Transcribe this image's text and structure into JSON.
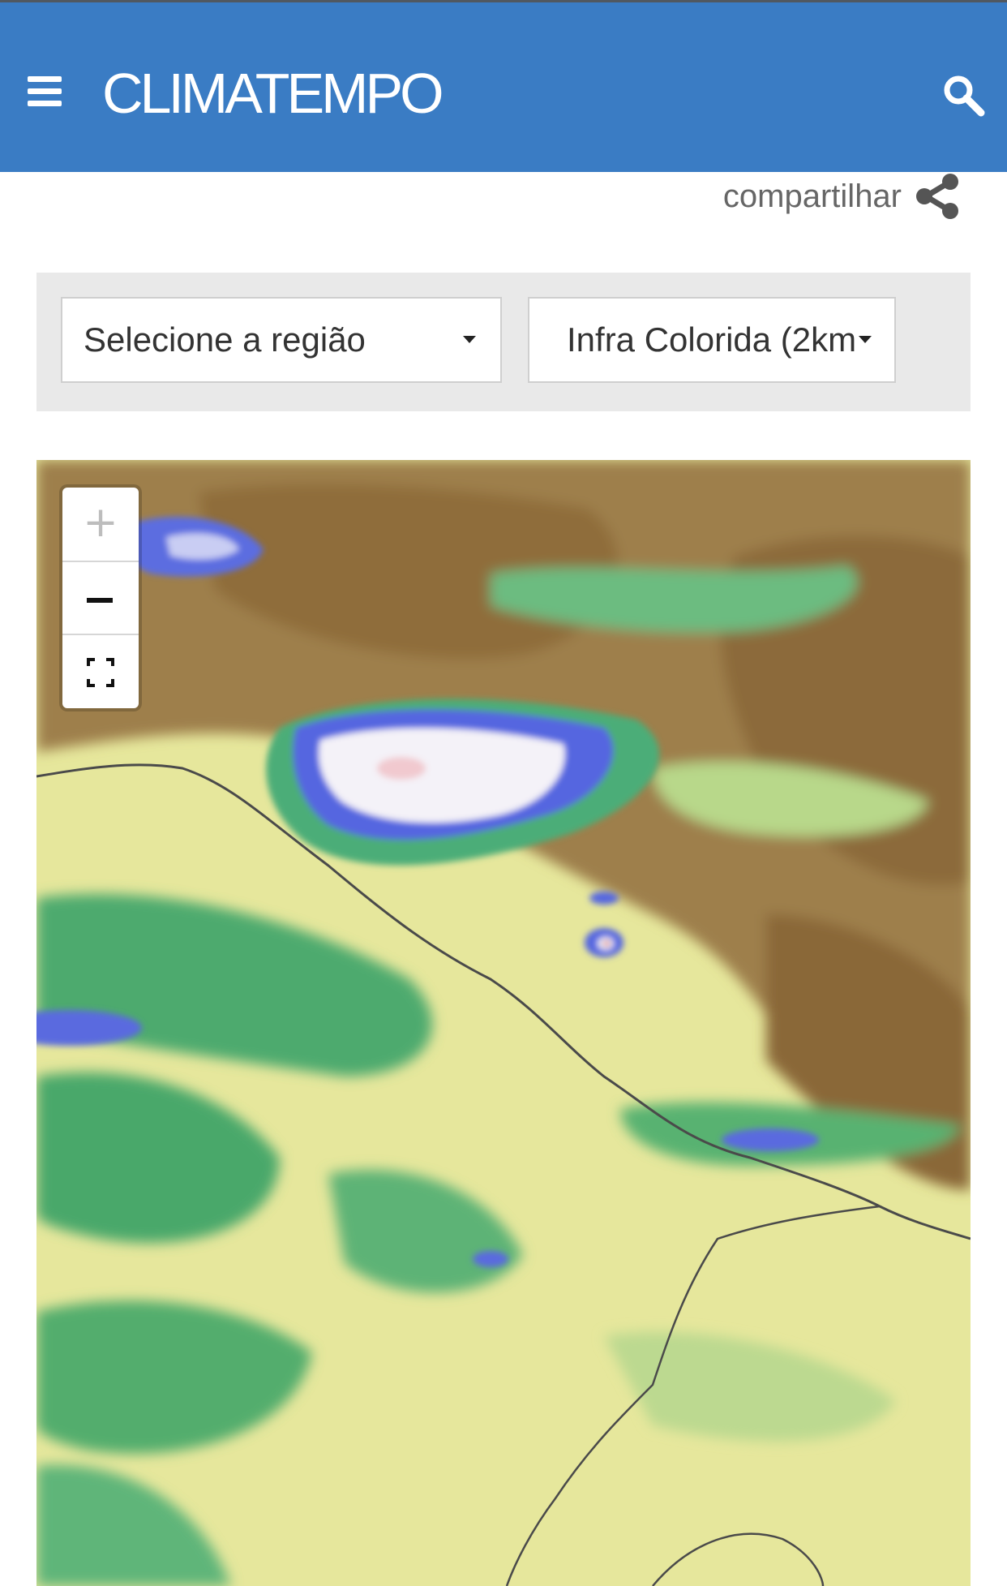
{
  "header": {
    "brand": "CLIMATEMPO",
    "background_color": "#3a7cc4",
    "menu_icon": "hamburger-menu-icon",
    "search_icon": "search-icon"
  },
  "share": {
    "label": "compartilhar",
    "icon": "share-icon"
  },
  "filters": {
    "region_select": {
      "value": "Selecione a região"
    },
    "layer_select": {
      "value": "Infra Colorida (2km"
    }
  },
  "map": {
    "type": "satellite infrared colored imagery",
    "controls": {
      "zoom_in_label": "+",
      "zoom_out_icon": "minus-icon",
      "fullscreen_icon": "fullscreen-icon"
    }
  }
}
